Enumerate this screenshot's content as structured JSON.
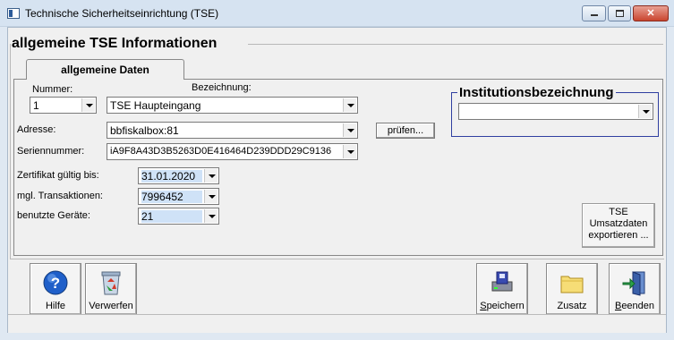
{
  "window": {
    "title": "Technische Sicherheitseinrichtung (TSE)",
    "minimize_glyph": "",
    "maximize_glyph": "",
    "close_glyph": "✕"
  },
  "group": {
    "title": "allgemeine TSE Informationen"
  },
  "tab": {
    "label": "allgemeine Daten"
  },
  "form": {
    "nummer_label": "Nummer:",
    "nummer_value": "1",
    "bezeichnung_label": "Bezeichnung:",
    "bezeichnung_value": "TSE Haupteingang",
    "adresse_label": "Adresse:",
    "adresse_value": "bbfiskalbox:81",
    "pruefen_label": "prüfen...",
    "seriennummer_label": "Seriennummer:",
    "seriennummer_value": "iA9F8A43D3B5263D0E416464D239DDD29C9136",
    "zertifikat_label": "Zertifikat gültig bis:",
    "zertifikat_value": "31.01.2020",
    "transaktionen_label": "mgl. Transaktionen:",
    "transaktionen_value": "7996452",
    "geraete_label": "benutzte Geräte:",
    "geraete_value": "21"
  },
  "institution": {
    "title": "Institutionsbezeichnung",
    "value": ""
  },
  "tse_export": {
    "line1": "TSE",
    "line2": "Umsatzdaten",
    "line3": "exportieren ..."
  },
  "toolbar": {
    "hilfe": "Hilfe",
    "verwerfen": "Verwerfen",
    "speichern_first": "S",
    "speichern_rest": "peichern",
    "zusatz": "Zusatz",
    "beenden_first": "B",
    "beenden_rest": "eenden"
  },
  "icons": {
    "app": "app-icon",
    "help": "help-icon",
    "discard": "recycle-bin-icon",
    "save": "save-disk-icon",
    "extra": "folder-icon",
    "exit": "exit-door-icon"
  },
  "colors": {
    "accent_blue": "#2f3fa0",
    "help_blue": "#1f5fc9",
    "close_red": "#c9452f"
  }
}
